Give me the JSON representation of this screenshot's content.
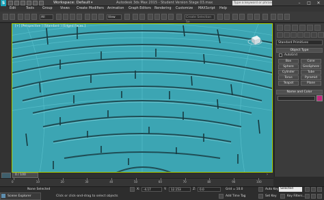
{
  "titlebar": {
    "workspace_label": "Workspace: Default",
    "window_title": "Autodesk 3ds Max 2015 - Student Version   Stage 03.max",
    "search_placeholder": "Type a keyword or phrase"
  },
  "menu": [
    "Edit",
    "Tools",
    "Group",
    "Views",
    "Create",
    "Modifiers",
    "Animation",
    "Graph Editors",
    "Rendering",
    "Customize",
    "MAXScript",
    "Help"
  ],
  "toolbar": {
    "filter_value": "All",
    "view_value": "View",
    "selection_set_placeholder": "Create Selection Se"
  },
  "viewport": {
    "label": "[+] [Perspective ] [Standard ] [Edged Faces ]",
    "background": "#3ca5b3",
    "border_color": "#aad000"
  },
  "command_panel": {
    "category": "Standard Primitives",
    "object_type_header": "Object Type",
    "autogrid_label": "AutoGrid",
    "objects": [
      "Box",
      "Cone",
      "Sphere",
      "GeoSphere",
      "Cylinder",
      "Tube",
      "Torus",
      "Pyramid",
      "Teapot",
      "Plane"
    ],
    "name_color_header": "Name and Color",
    "object_color": "#c0287c"
  },
  "timeline": {
    "frame_display": "0 / 100",
    "ticks": [
      "0",
      "10",
      "20",
      "30",
      "40",
      "50",
      "60",
      "70",
      "80",
      "90",
      "100"
    ]
  },
  "status": {
    "selection": "None Selected",
    "hint": "Click or click-and-drag to select objects",
    "scene_explorer": "Scene Explorer",
    "x_label": "X:",
    "x_value": "-4.17",
    "y_label": "Y:",
    "y_value": "12.153",
    "z_label": "Z:",
    "z_value": "0.0",
    "grid": "Grid = 10.0",
    "add_time_tag": "Add Time Tag",
    "auto_key": "Auto Key",
    "key_mode": "Selected",
    "set_key": "Set Key",
    "key_filters": "Key Filters..."
  }
}
